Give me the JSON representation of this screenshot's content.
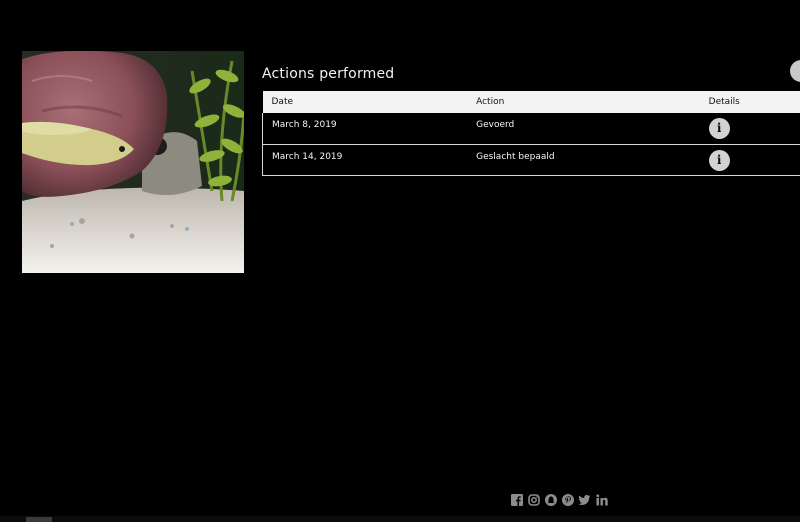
{
  "section": {
    "title": "Actions performed"
  },
  "table": {
    "headers": [
      "Date",
      "Action",
      "Details"
    ],
    "rows": [
      {
        "date": "March 8, 2019",
        "action": "Gevoerd",
        "details_icon": "info-icon"
      },
      {
        "date": "March 14, 2019",
        "action": "Geslacht bepaald",
        "details_icon": "info-icon"
      }
    ]
  },
  "social": {
    "icons": [
      "facebook-icon",
      "instagram-icon",
      "snapchat-icon",
      "pinterest-icon",
      "twitter-icon",
      "linkedin-icon"
    ]
  },
  "colors": {
    "background": "#000000",
    "header_row": "#f3f3f3",
    "info_button": "#d2d2d2",
    "icon_gray": "#8c8c8c"
  }
}
